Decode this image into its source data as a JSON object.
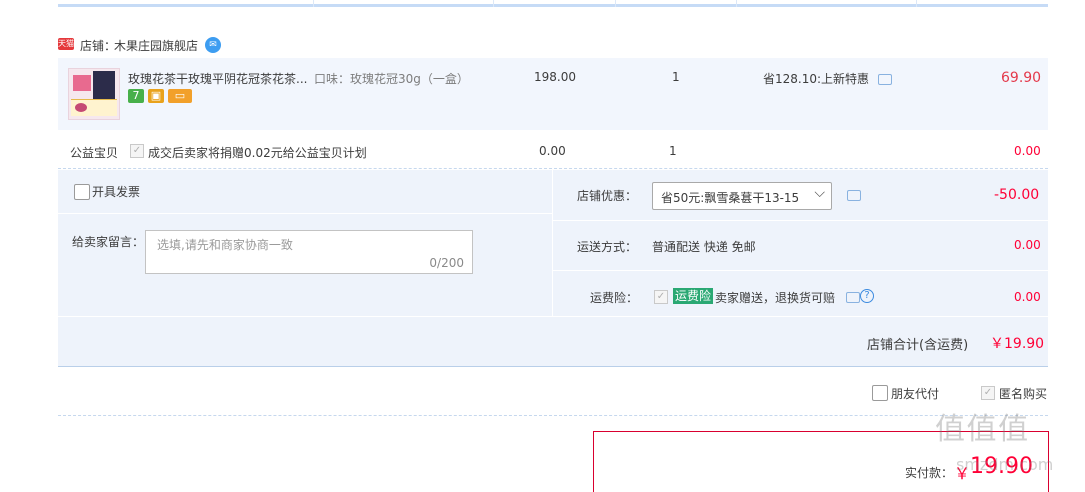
{
  "shop": {
    "tmall_badge": "天猫",
    "label": "店铺：",
    "name": "木果庄园旗舰店"
  },
  "item": {
    "title": "玫瑰花茶干玫瑰平阴花冠茶花茶...",
    "sku": "口味：玫瑰花冠30g（一盒）",
    "badge_seven": "7",
    "price": "198.00",
    "qty": "1",
    "discount": "省128.10:上新特惠",
    "total": "69.90"
  },
  "charity": {
    "label": "公益宝贝",
    "desc": "成交后卖家将捐赠0.02元给公益宝贝计划",
    "price": "0.00",
    "qty": "1",
    "total": "0.00"
  },
  "invoice": {
    "label": "开具发票"
  },
  "message": {
    "label": "给卖家留言：",
    "placeholder": "选填,请先和商家协商一致",
    "counter": "0/200"
  },
  "promo": {
    "label": "店铺优惠：",
    "selected": "省50元:飘雪桑葚干13-15",
    "amount": "-50.00"
  },
  "shipping": {
    "label": "运送方式：",
    "value": "普通配送 快递 免邮",
    "amount": "0.00"
  },
  "insurance": {
    "label": "运费险：",
    "tag": "运费险",
    "desc": "卖家赠送，退换货可赔",
    "amount": "0.00"
  },
  "subtotal": {
    "label": "店铺合计(含运费)",
    "amount": "￥19.90"
  },
  "options": {
    "friend_pay": "朋友代付",
    "anonymous": "匿名购买"
  },
  "payment": {
    "label": "实付款：",
    "currency": "￥",
    "amount": "19.90"
  },
  "watermark": {
    "text": "值 值 值",
    "sub": "smzdm.com"
  },
  "colors": {
    "price_red": "#ff0036",
    "accent_blue": "#c6dbf6",
    "tag_green": "#2aa873",
    "border_red": "#d9002f"
  }
}
